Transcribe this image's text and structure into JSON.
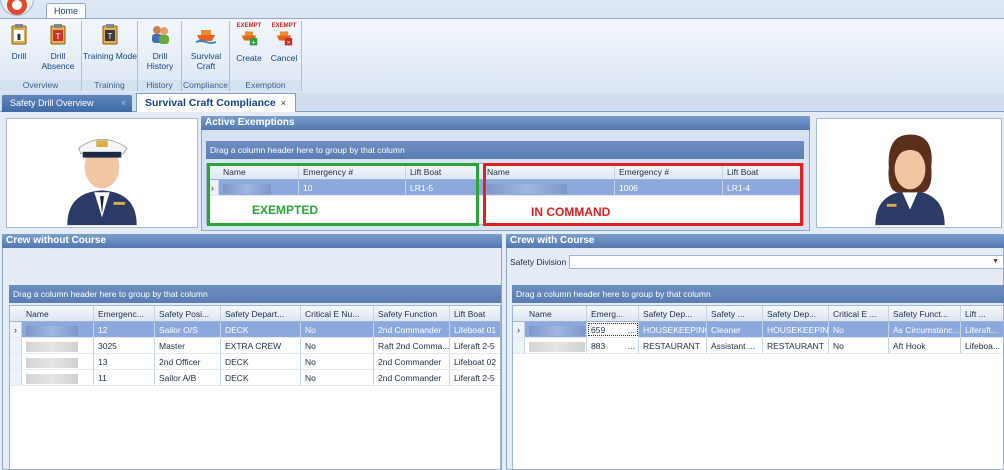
{
  "ribbon": {
    "tab_home": "Home",
    "groups": [
      {
        "label": "Overview",
        "buttons": [
          "Drill",
          "Drill\nAbsence"
        ]
      },
      {
        "label": "Training",
        "buttons": [
          "Training Mode"
        ]
      },
      {
        "label": "History",
        "buttons": [
          "Drill\nHistory"
        ]
      },
      {
        "label": "Compliance",
        "buttons": [
          "Survival\nCraft"
        ]
      },
      {
        "label": "Exemption",
        "buttons": [
          "Create",
          "Cancel"
        ]
      }
    ],
    "exempt_badge": "EXEMPT"
  },
  "doc_tabs": {
    "overview": "Safety Drill Overview",
    "compliance": "Survival Craft Compliance",
    "close": "×"
  },
  "exemptions": {
    "title": "Active Exemptions",
    "groupby_hint": "Drag a column header here to group by that column",
    "left": {
      "columns": [
        "Name",
        "Emergency #",
        "Lift Boat"
      ],
      "row": {
        "emergency": "10",
        "lift_boat": "LR1-5"
      },
      "annotation": "EXEMPTED"
    },
    "right": {
      "columns": [
        "Name",
        "Emergency #",
        "Lift Boat"
      ],
      "row": {
        "emergency": "1006",
        "lift_boat": "LR1-4"
      },
      "annotation": "IN COMMAND"
    }
  },
  "crew_without": {
    "title": "Crew without Course",
    "groupby_hint": "Drag a column header here to group by that column",
    "columns": [
      "Name",
      "Emergenc...",
      "Safety Posi...",
      "Safety Depart...",
      "Critical E Nu...",
      "Safety Function",
      "Lift Boat"
    ],
    "rows": [
      {
        "emergency": "12",
        "position": "Sailor O/S",
        "department": "DECK",
        "critical": "No",
        "function": "2nd Commander",
        "lift_boat": "Lifeboat 01"
      },
      {
        "emergency": "3025",
        "position": "Master",
        "department": "EXTRA CREW",
        "critical": "No",
        "function": "Raft 2nd Comma...",
        "lift_boat": "Liferaft 2-5"
      },
      {
        "emergency": "13",
        "position": "2nd Officer",
        "department": "DECK",
        "critical": "No",
        "function": "2nd Commander",
        "lift_boat": "Lifeboat 02"
      },
      {
        "emergency": "11",
        "position": "Sailor A/B",
        "department": "DECK",
        "critical": "No",
        "function": "2nd Commander",
        "lift_boat": "Liferaft 2-5"
      }
    ]
  },
  "crew_with": {
    "title": "Crew with Course",
    "division_label": "Safety Division",
    "groupby_hint": "Drag a column header here to group by that column",
    "columns": [
      "Name",
      "Emerg...",
      "Safety Dep...",
      "Safety ...",
      "Safety Dep...",
      "Critical E ...",
      "Safety Funct...",
      "Lift ..."
    ],
    "rows": [
      {
        "emergency": "659",
        "ellipsis": "...",
        "dep1": "HOUSEKEEPING",
        "pos": "Cleaner",
        "dep2": "HOUSEKEEPING",
        "critical": "No",
        "function": "As Circumstanc...",
        "lift": "Liferaft..."
      },
      {
        "emergency": "883",
        "ellipsis": "...",
        "dep1": "RESTAURANT",
        "pos": "Assistant ...",
        "dep2": "RESTAURANT",
        "critical": "No",
        "function": "Aft Hook",
        "lift": "Lifeboa..."
      }
    ]
  },
  "colors": {
    "exempted": "#2aa636",
    "in_command": "#e01f1f",
    "selection": "#8da8dd"
  }
}
